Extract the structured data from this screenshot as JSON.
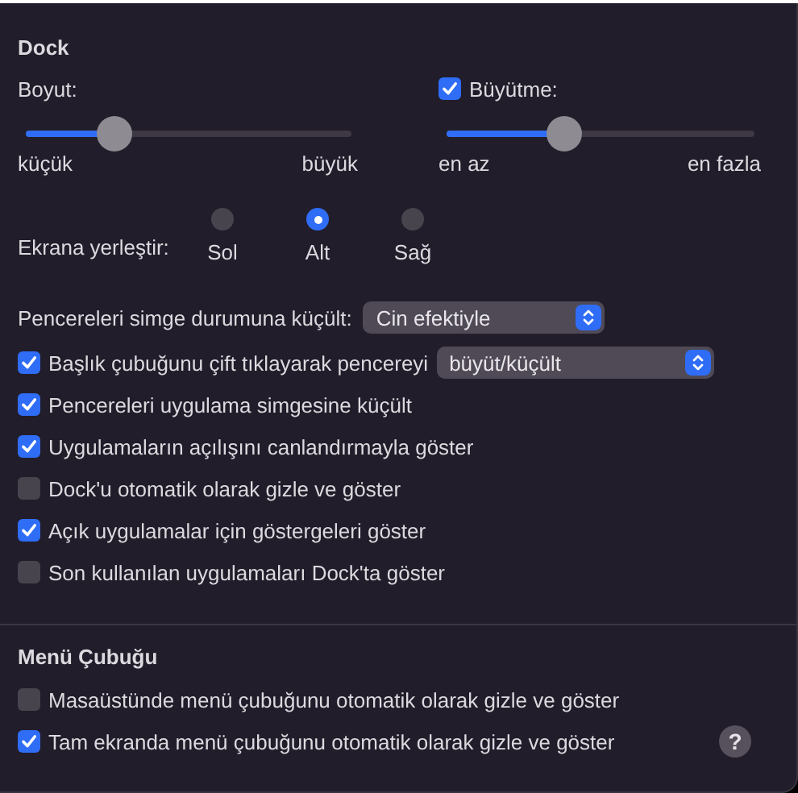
{
  "dock": {
    "title": "Dock",
    "size": {
      "label": "Boyut:",
      "level": 0.27,
      "min_label": "küçük",
      "max_label": "büyük"
    },
    "magnification": {
      "label": "Büyütme:",
      "checked": true,
      "level": 0.38,
      "min_label": "en az",
      "max_label": "en fazla"
    },
    "position": {
      "label": "Ekrana yerleştir:",
      "options": [
        {
          "label": "Sol",
          "selected": false
        },
        {
          "label": "Alt",
          "selected": true
        },
        {
          "label": "Sağ",
          "selected": false
        }
      ]
    },
    "minimize": {
      "label": "Pencereleri simge durumuna küçült:",
      "popup": "Cin efektiyle"
    },
    "options": [
      {
        "label": "Başlık çubuğunu çift tıklayarak pencereyi",
        "checked": true,
        "popup": "büyüt/küçült"
      },
      {
        "label": "Pencereleri uygulama simgesine küçült",
        "checked": true
      },
      {
        "label": "Uygulamaların açılışını canlandırmayla göster",
        "checked": true
      },
      {
        "label": "Dock'u otomatik olarak gizle ve göster",
        "checked": false
      },
      {
        "label": "Açık uygulamalar için göstergeleri göster",
        "checked": true
      },
      {
        "label": "Son kullanılan uygulamaları Dock'ta göster",
        "checked": false
      }
    ]
  },
  "menu_bar": {
    "title": "Menü Çubuğu",
    "options": [
      {
        "label": "Masaüstünde menü çubuğunu otomatik olarak gizle ve göster",
        "checked": false
      },
      {
        "label": "Tam ekranda menü çubuğunu otomatik olarak gizle ve göster",
        "checked": true
      }
    ]
  },
  "help_button": "?"
}
